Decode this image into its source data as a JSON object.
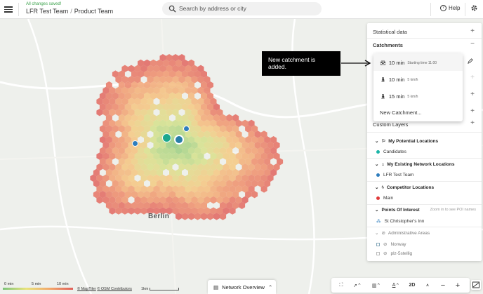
{
  "header": {
    "save_status": "All changes saved!",
    "team": "LFR Test Team",
    "separator": "/",
    "project": "Product Team",
    "help_label": "Help"
  },
  "search": {
    "placeholder": "Search by address or city"
  },
  "map": {
    "city_label": "Berlin"
  },
  "panel": {
    "statistical_data": "Statistical data",
    "catchments": "Catchments",
    "custom_layers": "Custom Layers",
    "groups": [
      {
        "title": "My Potential Locations",
        "item": "Candidates",
        "color": "#1cb5a8"
      },
      {
        "title": "My Existing Network Locations",
        "item": "LFR Test Team",
        "color": "#2e7dbd"
      },
      {
        "title": "Competitor Locations",
        "item": "Main",
        "color": "#e03a3a"
      }
    ],
    "poi": {
      "title": "Points Of Interest",
      "hint": "Zoom in to see POI names",
      "item": "St Christopher's Inn"
    },
    "admin": {
      "title": "Administrative Areas",
      "items": [
        "Norway",
        "plz-5stellig"
      ]
    }
  },
  "catchment_popup": {
    "items": [
      {
        "time": "10 min",
        "detail": "Starting time 11:00",
        "mode": "car"
      },
      {
        "time": "10 min",
        "detail": "5 km/h",
        "mode": "walk"
      },
      {
        "time": "15 min",
        "detail": "5 km/h",
        "mode": "walk"
      }
    ],
    "new_label": "New Catchment..."
  },
  "annotation": {
    "text": "New catchment is added."
  },
  "legend": {
    "labels": [
      "0 min",
      "5 min",
      "10 min"
    ]
  },
  "attribution": {
    "maptiler": "© MapTiler",
    "osm": "© OSM Contributors"
  },
  "scale": {
    "label": "1km"
  },
  "bottom_tab": {
    "label": "Network Overview"
  },
  "toolbar": {
    "mode_label": "2D"
  },
  "colors": {
    "accent": "#2a7fa8",
    "saved_green": "#3aa14a"
  }
}
